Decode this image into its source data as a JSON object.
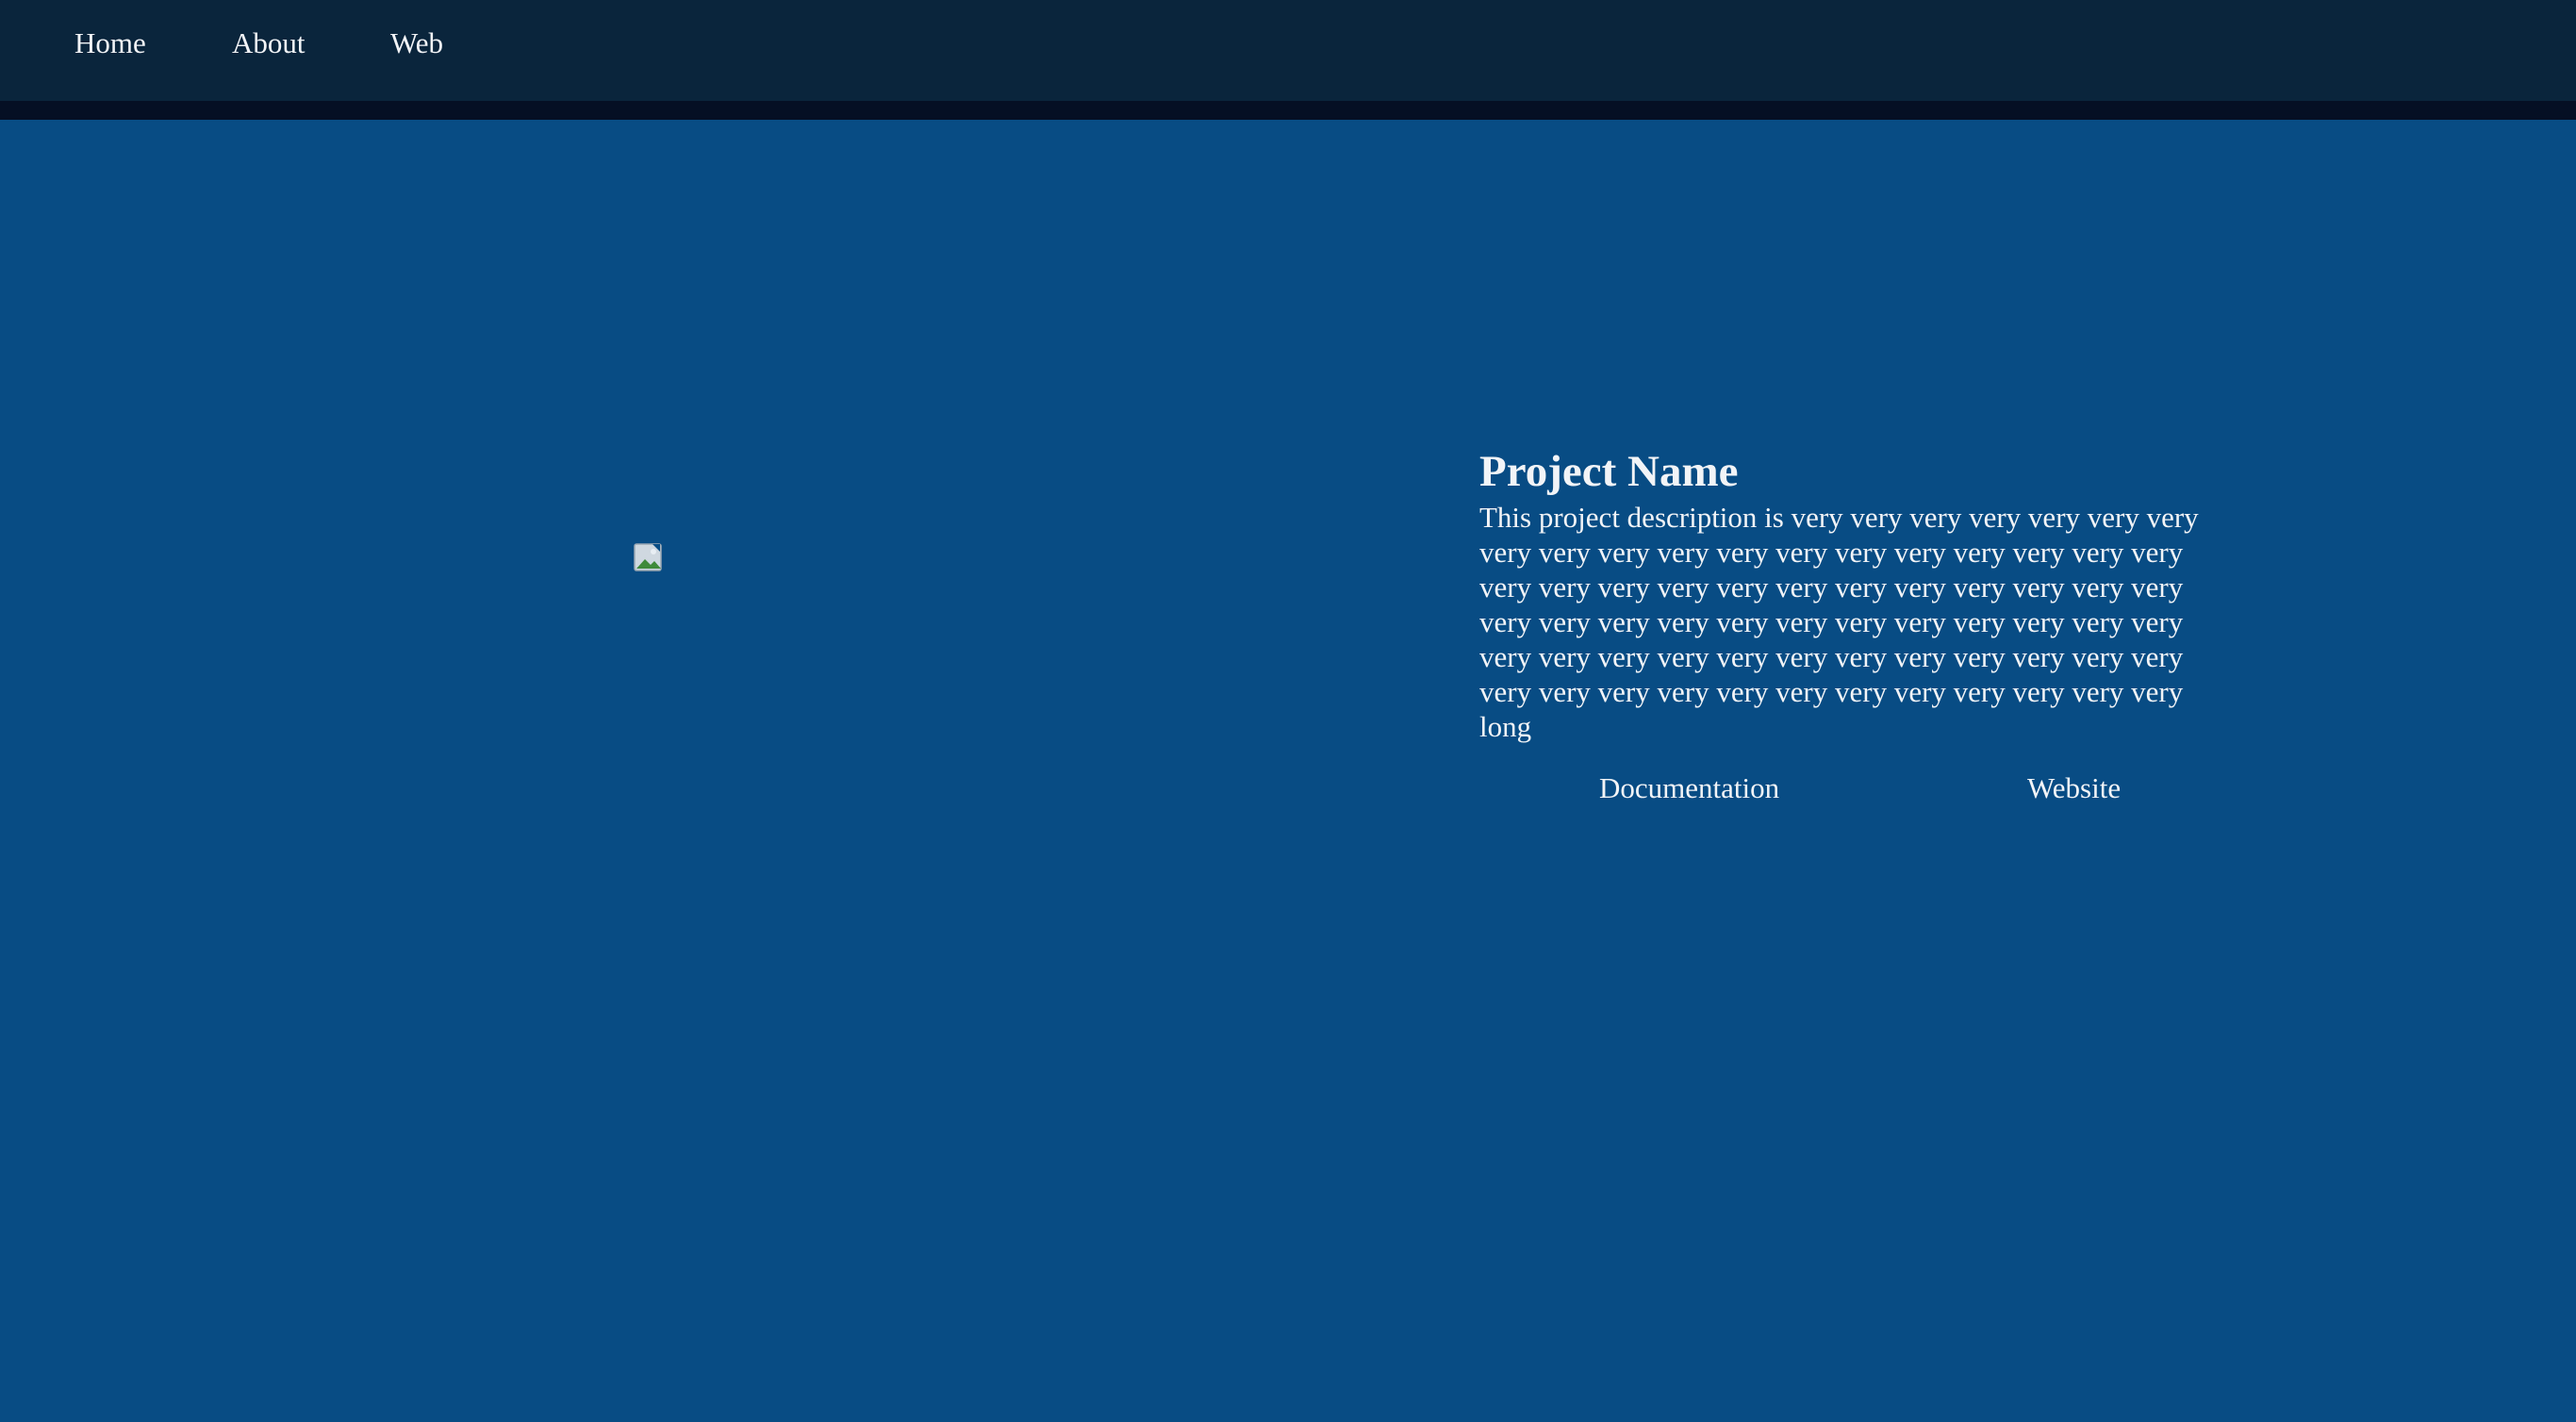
{
  "nav": {
    "items": [
      {
        "label": "Home"
      },
      {
        "label": "About"
      },
      {
        "label": "Web"
      }
    ]
  },
  "project": {
    "title": "Project Name",
    "description": "This project description is very very very very very very very very very very very very very very very very very very very very very very very very very very very very very very very very very very very very very very very very very very very very very very very very very very very very very very very very very very very very very very very very very very very long",
    "image_icon": "broken-image-icon"
  },
  "actions": {
    "documentation_label": "Documentation",
    "website_label": "Website"
  },
  "colors": {
    "background": "#084c84",
    "navbar": "#0a253c",
    "navbar_border": "#050f24",
    "text": "#f2f4f7"
  }
}
